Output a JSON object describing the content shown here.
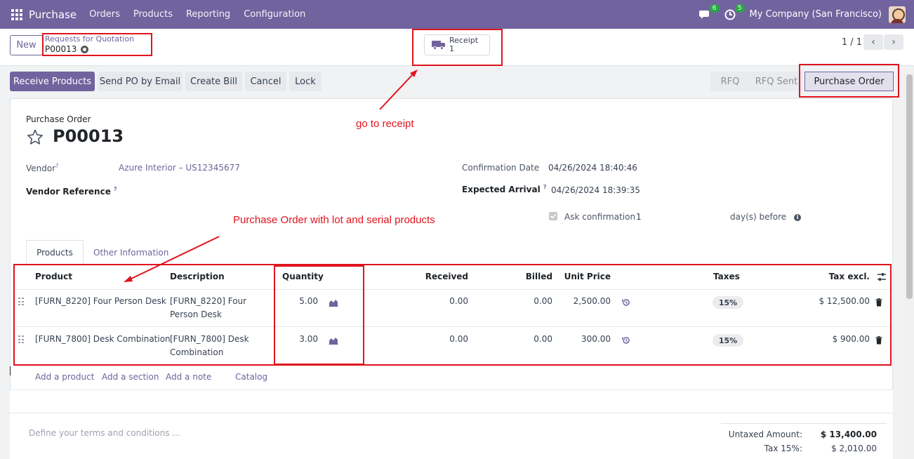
{
  "navbar": {
    "brand": "Purchase",
    "menu": [
      "Orders",
      "Products",
      "Reporting",
      "Configuration"
    ],
    "chat_count": "6",
    "activity_count": "5",
    "company": "My Company (San Francisco)"
  },
  "control_panel": {
    "new_label": "New",
    "breadcrumb_parent": "Requests for Quotation",
    "breadcrumb_current": "P00013",
    "smart_button_label": "Receipt",
    "smart_button_count": "1",
    "pager": "1 / 1"
  },
  "actions": {
    "receive": "Receive Products",
    "send_email": "Send PO by Email",
    "create_bill": "Create Bill",
    "cancel": "Cancel",
    "lock": "Lock"
  },
  "stages": [
    "RFQ",
    "RFQ Sent",
    "Purchase Order"
  ],
  "form": {
    "doc_type": "Purchase Order",
    "name": "P00013",
    "vendor_label": "Vendor",
    "vendor_value": "Azure Interior – US12345677",
    "vendor_ref_label": "Vendor Reference",
    "confirmation_date_label": "Confirmation Date",
    "confirmation_date_value": "04/26/2024 18:40:46",
    "expected_arrival_label": "Expected Arrival",
    "expected_arrival_value": "04/26/2024 18:39:35",
    "ask_confirmation_label": "Ask confirmation",
    "ask_confirmation_days": "1",
    "days_before_label": "day(s) before",
    "help_mark": "?"
  },
  "tabs": [
    "Products",
    "Other Information"
  ],
  "table": {
    "headers": {
      "product": "Product",
      "description": "Description",
      "quantity": "Quantity",
      "received": "Received",
      "billed": "Billed",
      "unit_price": "Unit Price",
      "taxes": "Taxes",
      "tax_excl": "Tax excl."
    },
    "rows": [
      {
        "product": "[FURN_8220] Four Person Desk",
        "description_line1": "[FURN_8220] Four",
        "description_line2": "Person Desk",
        "quantity": "5.00",
        "received": "0.00",
        "billed": "0.00",
        "unit_price": "2,500.00",
        "tax": "15%",
        "subtotal": "$ 12,500.00"
      },
      {
        "product": "[FURN_7800] Desk Combination",
        "description_line1": "[FURN_7800] Desk",
        "description_line2": "Combination",
        "quantity": "3.00",
        "received": "0.00",
        "billed": "0.00",
        "unit_price": "300.00",
        "tax": "15%",
        "subtotal": "$ 900.00"
      }
    ],
    "add_product": "Add a product",
    "add_section": "Add a section",
    "add_note": "Add a note",
    "catalog": "Catalog"
  },
  "footer": {
    "terms_placeholder": "Define your terms and conditions ...",
    "untaxed_label": "Untaxed Amount:",
    "untaxed_value": "$ 13,400.00",
    "tax_label": "Tax 15%:",
    "tax_value": "$ 2,010.00"
  },
  "annotations": {
    "receipt": "go to receipt",
    "products": "Purchase Order with lot and serial products"
  },
  "colors": {
    "brand": "#71639e",
    "annotation": "#e0141c"
  }
}
